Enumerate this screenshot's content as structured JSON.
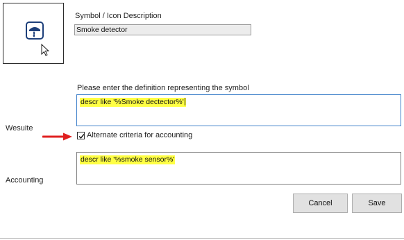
{
  "symbol": {
    "label": "Symbol / Icon Description",
    "value": "Smoke detector",
    "icon": "smoke-detector-icon"
  },
  "definition": {
    "prompt": "Please enter the definition representing the symbol",
    "row_label": "Wesuite",
    "value": "descr like '%Smoke dectector%'"
  },
  "alternate": {
    "checkbox_label": "Alternate criteria for accounting",
    "checked": true,
    "pointer": "red-arrow-icon"
  },
  "accounting": {
    "row_label": "Accounting",
    "value": "descr like '%smoke sensor%'"
  },
  "buttons": {
    "cancel": "Cancel",
    "save": "Save"
  },
  "colors": {
    "highlight": "#ffff44",
    "icon_blue": "#1d3f7a",
    "arrow_red": "#e02020",
    "focus_border": "#3d7fc9"
  }
}
